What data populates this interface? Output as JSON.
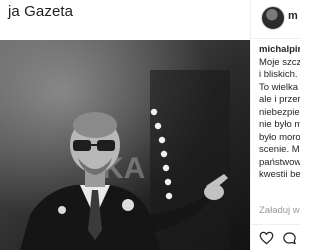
{
  "headline": {
    "text": "ja Gazeta"
  },
  "post": {
    "header_username": "m",
    "caption_username": "michalpira",
    "caption_lines": [
      "Moje szcz",
      "i bliskich.",
      "To wielka",
      "ale i przer",
      "niebezpie",
      "nie było m",
      "było moro",
      "scenie. Mo",
      "państwow",
      "kwestii be"
    ],
    "load_more_label": "Załaduj we"
  },
  "icons": {
    "like": "heart-icon",
    "comment": "comment-icon"
  }
}
